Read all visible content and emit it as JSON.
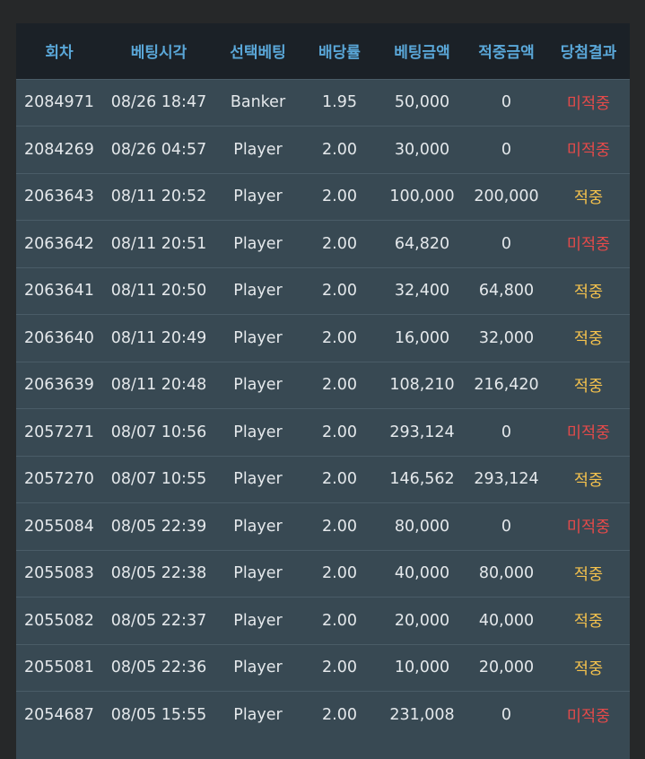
{
  "table": {
    "headers": {
      "round": "회차",
      "bet_time": "베팅시각",
      "selection": "선택베팅",
      "odds": "배당률",
      "bet_amount": "베팅금액",
      "win_amount": "적중금액",
      "result": "당첨결과"
    },
    "rows": [
      {
        "round": "2084971",
        "time": "08/26 18:47",
        "selection": "Banker",
        "odds": "1.95",
        "bet": "50,000",
        "win": "0",
        "result": "미적중",
        "status": "lose"
      },
      {
        "round": "2084269",
        "time": "08/26 04:57",
        "selection": "Player",
        "odds": "2.00",
        "bet": "30,000",
        "win": "0",
        "result": "미적중",
        "status": "lose"
      },
      {
        "round": "2063643",
        "time": "08/11 20:52",
        "selection": "Player",
        "odds": "2.00",
        "bet": "100,000",
        "win": "200,000",
        "result": "적중",
        "status": "win"
      },
      {
        "round": "2063642",
        "time": "08/11 20:51",
        "selection": "Player",
        "odds": "2.00",
        "bet": "64,820",
        "win": "0",
        "result": "미적중",
        "status": "lose"
      },
      {
        "round": "2063641",
        "time": "08/11 20:50",
        "selection": "Player",
        "odds": "2.00",
        "bet": "32,400",
        "win": "64,800",
        "result": "적중",
        "status": "win"
      },
      {
        "round": "2063640",
        "time": "08/11 20:49",
        "selection": "Player",
        "odds": "2.00",
        "bet": "16,000",
        "win": "32,000",
        "result": "적중",
        "status": "win"
      },
      {
        "round": "2063639",
        "time": "08/11 20:48",
        "selection": "Player",
        "odds": "2.00",
        "bet": "108,210",
        "win": "216,420",
        "result": "적중",
        "status": "win"
      },
      {
        "round": "2057271",
        "time": "08/07 10:56",
        "selection": "Player",
        "odds": "2.00",
        "bet": "293,124",
        "win": "0",
        "result": "미적중",
        "status": "lose"
      },
      {
        "round": "2057270",
        "time": "08/07 10:55",
        "selection": "Player",
        "odds": "2.00",
        "bet": "146,562",
        "win": "293,124",
        "result": "적중",
        "status": "win"
      },
      {
        "round": "2055084",
        "time": "08/05 22:39",
        "selection": "Player",
        "odds": "2.00",
        "bet": "80,000",
        "win": "0",
        "result": "미적중",
        "status": "lose"
      },
      {
        "round": "2055083",
        "time": "08/05 22:38",
        "selection": "Player",
        "odds": "2.00",
        "bet": "40,000",
        "win": "80,000",
        "result": "적중",
        "status": "win"
      },
      {
        "round": "2055082",
        "time": "08/05 22:37",
        "selection": "Player",
        "odds": "2.00",
        "bet": "20,000",
        "win": "40,000",
        "result": "적중",
        "status": "win"
      },
      {
        "round": "2055081",
        "time": "08/05 22:36",
        "selection": "Player",
        "odds": "2.00",
        "bet": "10,000",
        "win": "20,000",
        "result": "적중",
        "status": "win"
      },
      {
        "round": "2054687",
        "time": "08/05 15:55",
        "selection": "Player",
        "odds": "2.00",
        "bet": "231,008",
        "win": "0",
        "result": "미적중",
        "status": "lose"
      }
    ]
  },
  "colors": {
    "page_background": "#262829",
    "table_background": "#384953",
    "header_background": "#1b2127",
    "header_text": "#5aa7d8",
    "cell_text": "#e4e8eb",
    "win": "#f5c24d",
    "lose": "#e54a4a"
  }
}
